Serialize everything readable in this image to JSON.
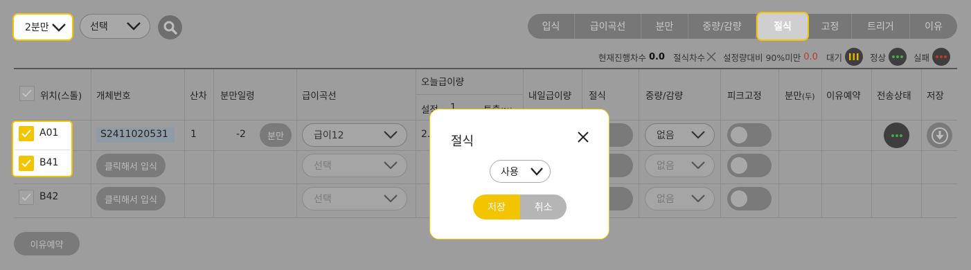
{
  "filters": {
    "split_select": "2분만",
    "choice_select": "선택"
  },
  "tabs": [
    "입식",
    "급이곡선",
    "분만",
    "중량/감량",
    "절식",
    "고정",
    "트리거",
    "이유"
  ],
  "active_tab": "절식",
  "status": {
    "current_round_label": "현재진행차수",
    "current_round_value": "0.0",
    "fasting_round_label": "절식차수",
    "under_setting_label": "설정량대비 90%미만",
    "under_setting_value": "0.0",
    "waiting_label": "대기",
    "normal_label": "정상",
    "failure_label": "실패",
    "colors": {
      "waiting": "#e0b400",
      "normal": "#4aa84a",
      "failure": "#c0392b",
      "highlight": "#f5c400"
    }
  },
  "table": {
    "headers": {
      "position": "위치(스톨)",
      "entity_no": "개체번호",
      "parity": "산차",
      "days_after_farrowing": "분만일령",
      "feed_curve": "급이곡선",
      "today_feed": "오늘급이량",
      "today_set": "설정",
      "today_one": "1",
      "today_output": "토출",
      "today_output_unit": "(%)",
      "tomorrow_feed": "내일급이량",
      "fasting": "절식",
      "weight_change": "중량/감량",
      "peak_fix": "피크고정",
      "farrowing_count": "분만",
      "farrowing_count_unit": "(두)",
      "weaning_reservation": "이유예약",
      "transfer_status": "전송상태",
      "save": "저장"
    },
    "rows": [
      {
        "position": "A01",
        "checked": true,
        "entity_no": "S2411020531",
        "parity": "1",
        "days": "-2",
        "farrow_button": "분만",
        "feed_curve": "급이12",
        "today_set": "2.",
        "weight_change": "없음"
      },
      {
        "position": "B41",
        "checked": true,
        "entity_button": "클릭해서 입식",
        "feed_curve": "선택",
        "weight_change": "없음"
      },
      {
        "position": "B42",
        "checked": false,
        "entity_button": "클릭해서 입식",
        "feed_curve": "선택",
        "weight_change": "없음"
      }
    ]
  },
  "weaning_reservation_button": "이유예약",
  "modal": {
    "title": "절식",
    "select_value": "사용",
    "save_label": "저장",
    "cancel_label": "취소"
  }
}
